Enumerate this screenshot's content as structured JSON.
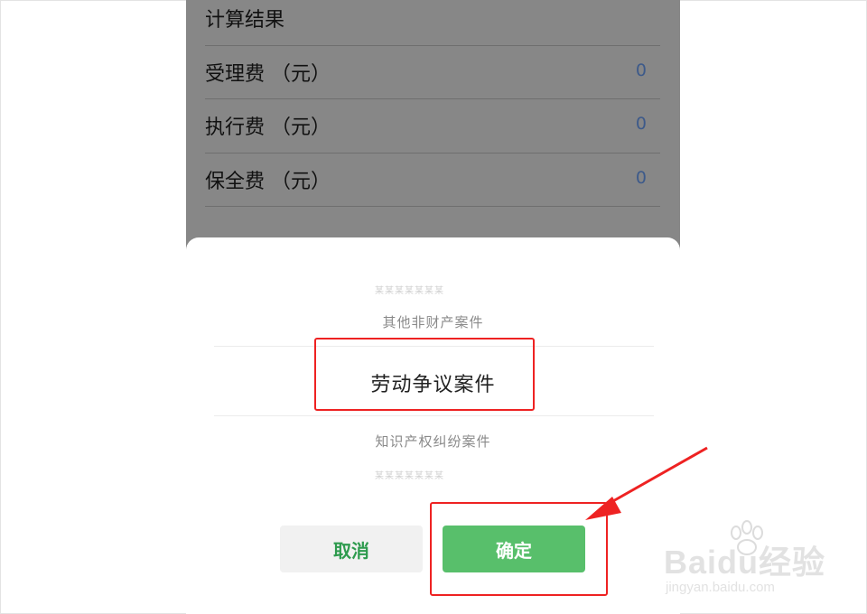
{
  "results": {
    "title": "计算结果",
    "rows": [
      {
        "label": "受理费 （元）",
        "value": "0"
      },
      {
        "label": "执行费 （元）",
        "value": "0"
      },
      {
        "label": "保全费 （元）",
        "value": "0"
      }
    ]
  },
  "picker": {
    "faded_top": "某某某某某某某",
    "items_above": [
      "其他非财产案件"
    ],
    "selected": "劳动争议案件",
    "items_below": [
      "知识产权纠纷案件"
    ],
    "faded_bottom": "某某某某某某某"
  },
  "buttons": {
    "cancel_label": "取消",
    "confirm_label": "确定"
  },
  "colors": {
    "confirm": "#58bf6b",
    "cancel_text": "#2e9b4e",
    "annotation": "#ee2222",
    "value_text": "#3d5a8a"
  },
  "watermark": {
    "brand": "Baidu经验",
    "url": "jingyan.baidu.com"
  }
}
